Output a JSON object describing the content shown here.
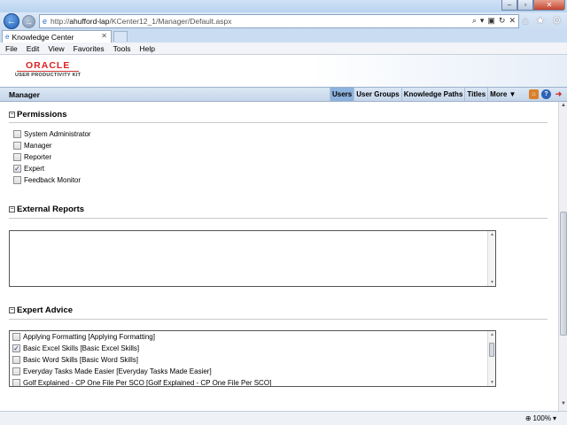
{
  "browser": {
    "url_prefix": "http://",
    "url_host": "ahufford-lap",
    "url_path": "/KCenter12_1/Manager/Default.aspx",
    "tab_title": "Knowledge Center",
    "menu": [
      "File",
      "Edit",
      "View",
      "Favorites",
      "Tools",
      "Help"
    ],
    "zoom": "100%"
  },
  "logo": {
    "brand": "ORACLE",
    "product": "USER PRODUCTIVITY KIT"
  },
  "appbar": {
    "title": "Manager",
    "nav": [
      "Users",
      "User Groups",
      "Knowledge Paths",
      "Titles",
      "More ▼"
    ],
    "active_nav": "Users"
  },
  "permissions": {
    "heading": "Permissions",
    "items": [
      {
        "label": "System Administrator",
        "checked": false
      },
      {
        "label": "Manager",
        "checked": false
      },
      {
        "label": "Reporter",
        "checked": false
      },
      {
        "label": "Expert",
        "checked": true
      },
      {
        "label": "Feedback Monitor",
        "checked": false
      }
    ]
  },
  "reports": {
    "heading": "External Reports"
  },
  "advice": {
    "heading": "Expert Advice",
    "items": [
      {
        "label": "Applying Formatting [Applying Formatting]",
        "checked": false
      },
      {
        "label": "Basic Excel Skills [Basic Excel Skills]",
        "checked": true
      },
      {
        "label": "Basic Word Skills [Basic Word Skills]",
        "checked": false
      },
      {
        "label": "Everyday Tasks Made Easier [Everyday Tasks Made Easier]",
        "checked": false
      },
      {
        "label": "Golf Explained - CP One File Per SCO [Golf Explained - CP One File Per SCO]",
        "checked": false
      }
    ]
  }
}
